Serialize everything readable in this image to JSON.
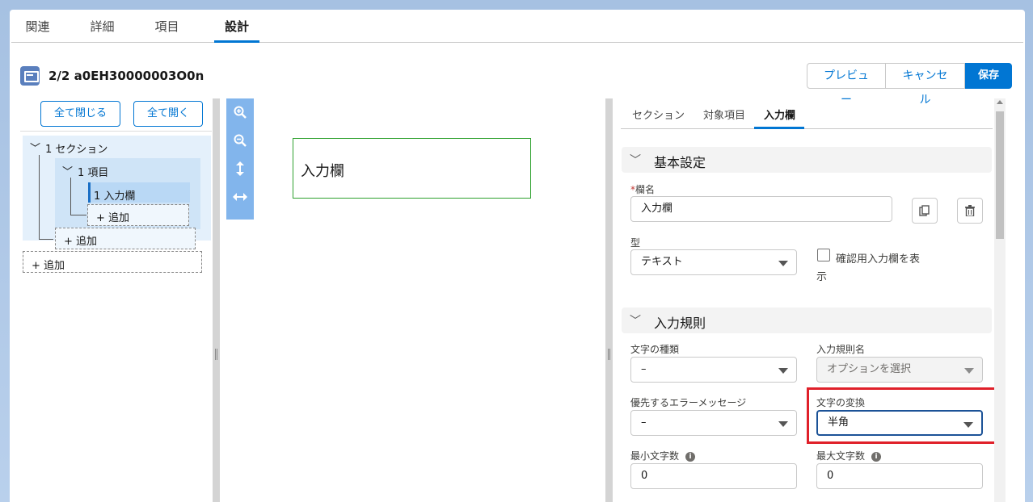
{
  "top_tabs": [
    "関連",
    "詳細",
    "項目",
    "設計"
  ],
  "active_top_tab": "設計",
  "record": {
    "title": "2/2 a0EH30000003O0n"
  },
  "actions": {
    "preview": "プレビュー",
    "cancel": "キャンセル",
    "save": "保存"
  },
  "tree": {
    "collapse_all": "全て閉じる",
    "expand_all": "全て開く",
    "section": "1 セクション",
    "item": "1 項目",
    "field": "1 入力欄",
    "add_field": "+ 追加",
    "add_item": "+ 追加",
    "add_section": "+ 追加"
  },
  "canvas": {
    "field_label": "入力欄"
  },
  "properties": {
    "tabs": [
      "セクション",
      "対象項目",
      "入力欄"
    ],
    "active_tab": "入力欄",
    "basic": {
      "title": "基本設定",
      "field_name_label": "欄名",
      "required_mark": "*",
      "field_name_value": "入力欄",
      "type_label": "型",
      "type_value": "テキスト",
      "confirm_label_1": "確認用入力欄を表",
      "confirm_label_2": "示"
    },
    "rules": {
      "title": "入力規則",
      "char_type_label": "文字の種類",
      "char_type_value": "–",
      "rule_name_label": "入力規則名",
      "rule_name_placeholder": "オプションを選択",
      "error_priority_label": "優先するエラーメッセージ",
      "error_priority_value": "–",
      "char_convert_label": "文字の変換",
      "char_convert_value": "半角",
      "min_length_label": "最小文字数",
      "min_length_value": "0",
      "max_length_label": "最大文字数",
      "max_length_value": "0"
    }
  },
  "colors": {
    "accent": "#0176d3",
    "highlight": "#e0202a",
    "canvas_border": "#2ea12e"
  },
  "icons": [
    "record-icon",
    "zoom-in-icon",
    "zoom-out-icon",
    "fit-vertical-icon",
    "fit-horizontal-icon",
    "copy-icon",
    "delete-icon",
    "info-icon"
  ]
}
